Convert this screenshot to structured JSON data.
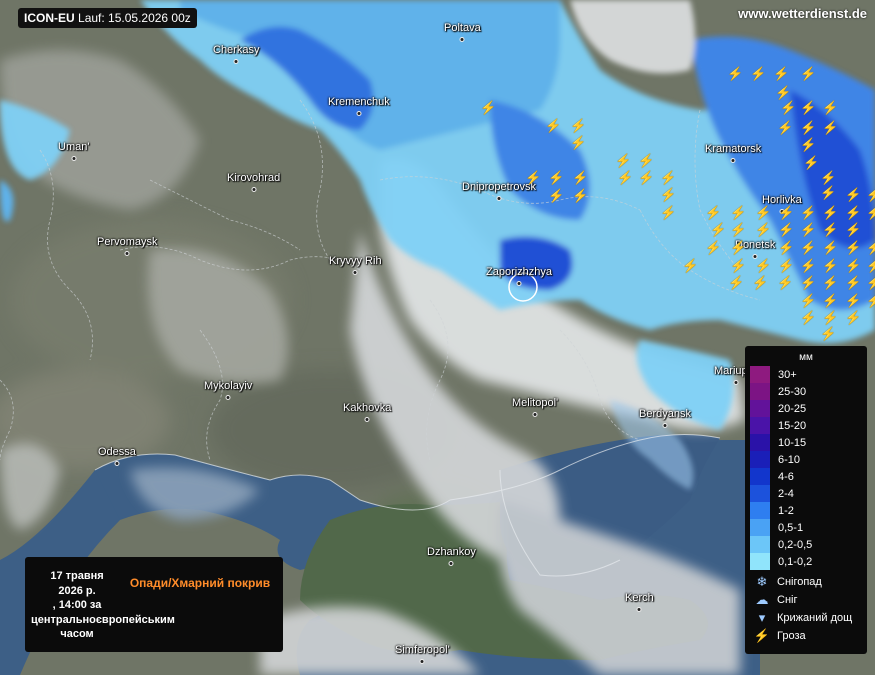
{
  "header": {
    "model_run_label": "ICON-EU",
    "model_run_value": "Lauf: 15.05.2026 00z",
    "watermark": "www.wetterdienst.de"
  },
  "cities": [
    {
      "name": "Cherkasy"
    },
    {
      "name": "Poltava"
    },
    {
      "name": "Kremenchuk"
    },
    {
      "name": "Uman'"
    },
    {
      "name": "Kirovohrad"
    },
    {
      "name": "Kramatorsk"
    },
    {
      "name": "Dnipropetrovsk"
    },
    {
      "name": "Horlivka"
    },
    {
      "name": "Pervomaysk"
    },
    {
      "name": "Donetsk"
    },
    {
      "name": "Kryvyy Rih"
    },
    {
      "name": "Zaporizhzhya"
    },
    {
      "name": "Mariupol'"
    },
    {
      "name": "Mykolayiv"
    },
    {
      "name": "Kakhovka"
    },
    {
      "name": "Melitopol'"
    },
    {
      "name": "Berdyansk"
    },
    {
      "name": "Odessa"
    },
    {
      "name": "Dzhankoy"
    },
    {
      "name": "Kerch"
    },
    {
      "name": "Simferopol'"
    }
  ],
  "legend": {
    "unit": "мм",
    "classes": [
      {
        "label": "30+",
        "color": "#8e1a7f"
      },
      {
        "label": "25-30",
        "color": "#7c1484"
      },
      {
        "label": "20-25",
        "color": "#62129a"
      },
      {
        "label": "15-20",
        "color": "#4a13a8"
      },
      {
        "label": "10-15",
        "color": "#2a12a8"
      },
      {
        "label": "6-10",
        "color": "#1a1fb8"
      },
      {
        "label": "4-6",
        "color": "#1236cc"
      },
      {
        "label": "2-4",
        "color": "#1c52dc"
      },
      {
        "label": "1-2",
        "color": "#2e7ef0"
      },
      {
        "label": "0,5-1",
        "color": "#4aa2f4"
      },
      {
        "label": "0,2-0,5",
        "color": "#6cc6f8"
      },
      {
        "label": "0,1-0,2",
        "color": "#90e4fb"
      }
    ],
    "symbols": [
      {
        "label": "Снігопад",
        "icon": "snowflake-icon"
      },
      {
        "label": "Сніг",
        "icon": "snow-cloud-icon"
      },
      {
        "label": "Крижаний дощ",
        "icon": "freezing-rain-icon"
      },
      {
        "label": "Гроза",
        "icon": "lightning-icon"
      }
    ]
  },
  "infobox": {
    "date_line1": "17 травня",
    "date_line2": "2026 р.",
    "date_line3": ", 14:00 за",
    "date_line4": "центральноєвропейським",
    "date_line5": "часом",
    "title": "Опади/Хмарний покрив"
  },
  "colors": {
    "sea": "#3d5f86",
    "land": "#6f7566",
    "cloud": "#d8dbdc",
    "lightning": "#ffd21e",
    "accent_title": "#ff8c2a"
  }
}
